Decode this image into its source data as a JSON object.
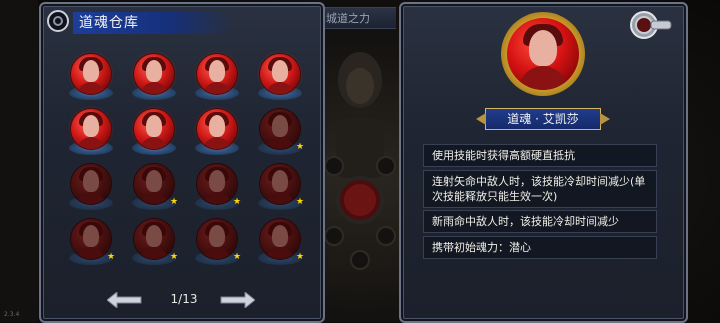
{
  "version": "2.3.4",
  "background": {
    "tab_label": "城道之力"
  },
  "left_panel": {
    "title": "道魂仓库",
    "slots": [
      {
        "dim": false,
        "star": false
      },
      {
        "dim": false,
        "star": false
      },
      {
        "dim": false,
        "star": false
      },
      {
        "dim": false,
        "star": false
      },
      {
        "dim": false,
        "star": false
      },
      {
        "dim": false,
        "star": false
      },
      {
        "dim": false,
        "star": false
      },
      {
        "dim": true,
        "star": true
      },
      {
        "dim": true,
        "star": false
      },
      {
        "dim": true,
        "star": true
      },
      {
        "dim": true,
        "star": true
      },
      {
        "dim": true,
        "star": true
      },
      {
        "dim": true,
        "star": true
      },
      {
        "dim": true,
        "star": true
      },
      {
        "dim": true,
        "star": true
      },
      {
        "dim": true,
        "star": true
      }
    ],
    "page_indicator": "1/13"
  },
  "right_panel": {
    "name": "道魂 · 艾凯莎",
    "skills": [
      "使用技能时获得高额硬直抵抗",
      "连射矢命中敌人时，该技能冷却时间减少(单次技能释放只能生效一次)",
      "新雨命中敌人时，该技能冷却时间减少",
      "携带初始魂力：潜心"
    ]
  },
  "colors": {
    "panel_border": "#6a7388",
    "title_blue": "#1c3e9a",
    "orb_red": "#d01a18",
    "star_yellow": "#ffd400",
    "gold": "#c89a2a"
  },
  "icons": {
    "corner": "ring-ornament-icon",
    "prev": "arrow-left-icon",
    "next": "arrow-right-icon",
    "close": "close-knob-icon",
    "star": "star-icon"
  }
}
